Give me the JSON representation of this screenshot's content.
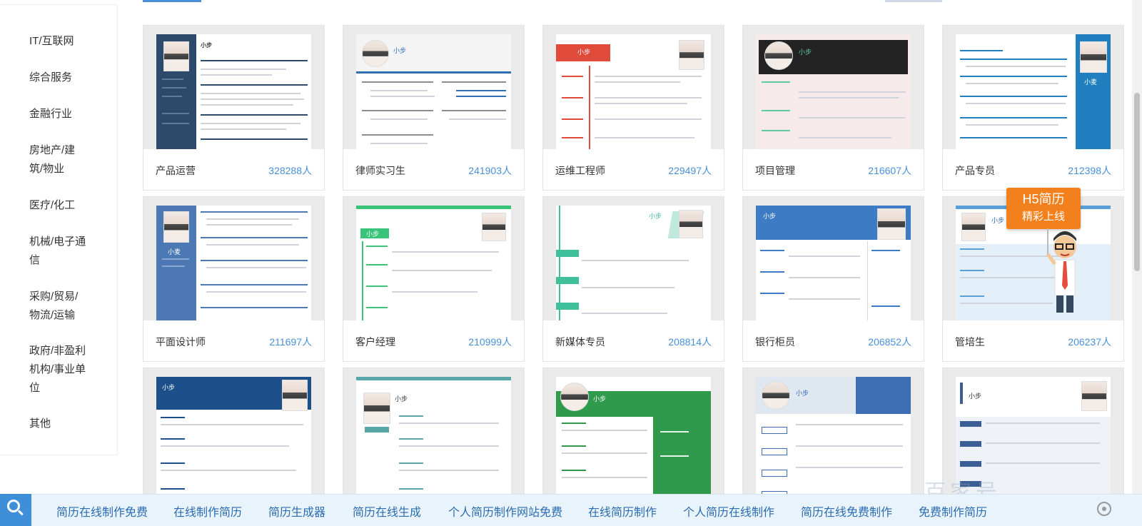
{
  "sidebar": {
    "items": [
      {
        "label": "IT/互联网"
      },
      {
        "label": "综合服务"
      },
      {
        "label": "金融行业"
      },
      {
        "label": "房地产/建筑/物业"
      },
      {
        "label": "医疗/化工"
      },
      {
        "label": "机械/电子通信"
      },
      {
        "label": "采购/贸易/物流/运输"
      },
      {
        "label": "政府/非盈利机构/事业单位"
      },
      {
        "label": "其他"
      }
    ]
  },
  "cards": [
    {
      "title": "产品运营",
      "count": "328288人",
      "accent": "#2d4a6b"
    },
    {
      "title": "律师实习生",
      "count": "241903人",
      "accent": "#2f6fb5"
    },
    {
      "title": "运维工程师",
      "count": "229497人",
      "accent": "#e04b3c"
    },
    {
      "title": "项目管理",
      "count": "216607人",
      "accent": "#232323"
    },
    {
      "title": "产品专员",
      "count": "212398人",
      "accent": "#1f7fbf"
    },
    {
      "title": "平面设计师",
      "count": "211697人",
      "accent": "#4c79b4"
    },
    {
      "title": "客户经理",
      "count": "210999人",
      "accent": "#39c47a"
    },
    {
      "title": "新媒体专员",
      "count": "208814人",
      "accent": "#3fbf9a"
    },
    {
      "title": "银行柜员",
      "count": "206852人",
      "accent": "#3d7cc4"
    },
    {
      "title": "管培生",
      "count": "206237人",
      "accent": "#5aa0d8"
    },
    {
      "title": "",
      "count": "",
      "accent": "#1d4f8a"
    },
    {
      "title": "",
      "count": "",
      "accent": "#58a7a8"
    },
    {
      "title": "",
      "count": "",
      "accent": "#2f9a4c"
    },
    {
      "title": "",
      "count": "",
      "accent": "#3d6db3"
    },
    {
      "title": "",
      "count": "",
      "accent": "#3b5e95"
    }
  ],
  "thumb_text": {
    "name": "小步",
    "name_alt": "小麦"
  },
  "h5_badge": {
    "line1": "H5简历",
    "line2": "精彩上线"
  },
  "bottom_bar": {
    "keywords": [
      "简历在线制作免费",
      "在线制作简历",
      "简历生成器",
      "简历在线生成",
      "个人简历制作网站免费",
      "在线简历制作",
      "个人简历在线制作",
      "简历在线免费制作",
      "免费制作简历"
    ],
    "icon": "search-icon",
    "right_icon": "gear-icon"
  },
  "watermark": "百家号"
}
